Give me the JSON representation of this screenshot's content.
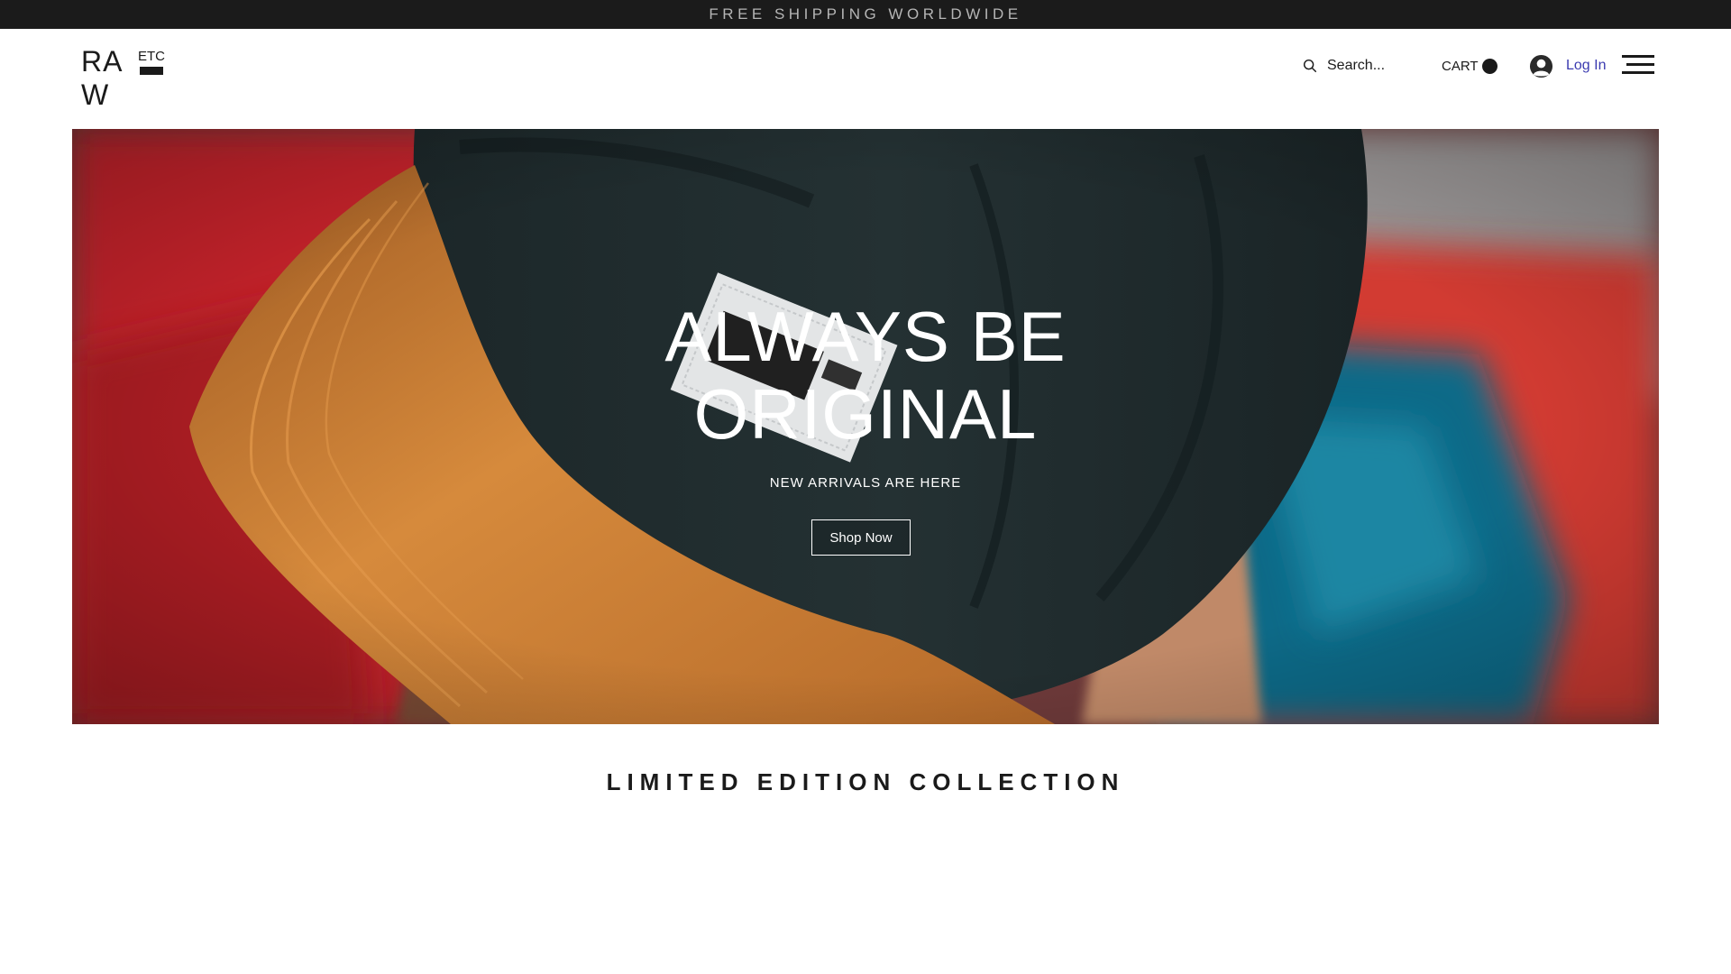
{
  "announcement": {
    "text": "FREE SHIPPING WORLDWIDE"
  },
  "header": {
    "logo": {
      "main": "RAW",
      "sub": "ETC"
    },
    "search": {
      "placeholder": "Search..."
    },
    "cart": {
      "label": "CART"
    },
    "login": {
      "label": "Log In"
    },
    "icons": {
      "search": "search-icon",
      "account": "account-icon",
      "menu": "hamburger-menu-icon"
    }
  },
  "hero": {
    "title": "ALWAYS BE ORIGINAL",
    "subtitle": "NEW ARRIVALS ARE HERE",
    "cta_label": "Shop Now",
    "image": "photo of a person wearing a black cap with a tan suede brim and a 'RAW ETC' patch"
  },
  "section": {
    "title": "LIMITED EDITION COLLECTION"
  },
  "colors": {
    "announcement_bg": "#1b1b1b",
    "announcement_text": "#b5b5b5",
    "login_link": "#3b3bb0",
    "text": "#1a1a1a"
  }
}
